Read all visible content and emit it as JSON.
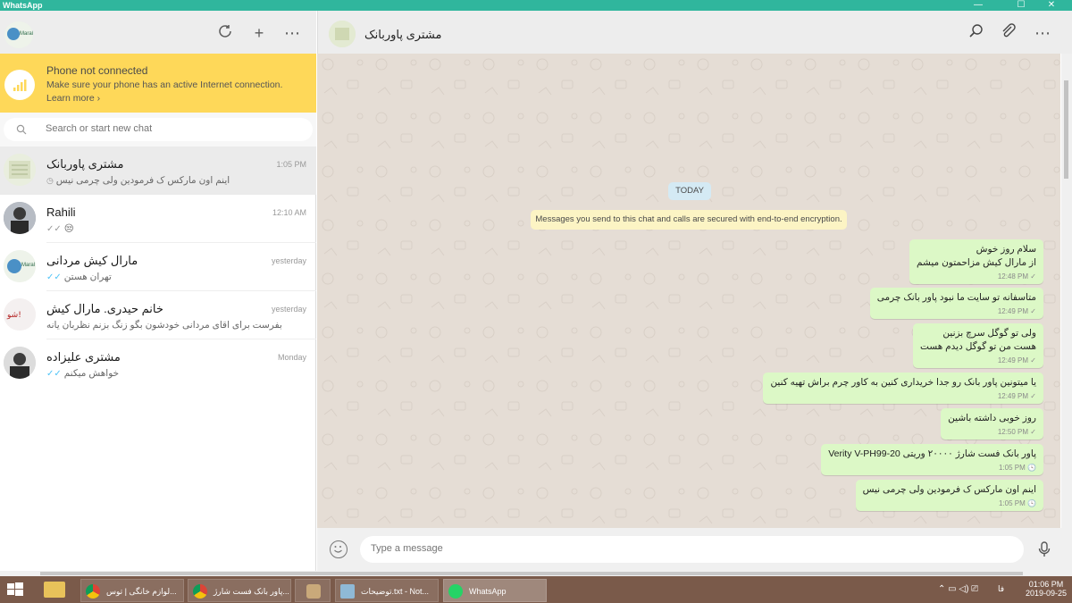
{
  "window": {
    "title": "WhatsApp",
    "minimize": "—",
    "maximize": "☐",
    "close": "✕"
  },
  "left_header": {
    "status_icon": "refresh-icon",
    "new_chat_icon": "+",
    "menu_icon": "⋯"
  },
  "notice": {
    "title": "Phone not connected",
    "line1": "Make sure your phone has an active Internet connection.",
    "link": "Learn more ›"
  },
  "search": {
    "placeholder": "Search or start new chat"
  },
  "chats": [
    {
      "name": "مشتری پاوربانک",
      "time": "1:05 PM",
      "preview": "اینم اون مارکس ک فرمودین ولی چرمی نیس",
      "status": "clock"
    },
    {
      "name": "Rahili",
      "time": "12:10 AM",
      "preview": "😒",
      "status": "✓✓"
    },
    {
      "name": "مارال کیش مردانی",
      "time": "yesterday",
      "preview": "تهران هستن",
      "status": "✓✓"
    },
    {
      "name": "خانم حیدری. مارال کیش",
      "time": "yesterday",
      "preview": "بفرست برای اقای مردانی خودشون بگو زنگ بزنم نظربان یانه",
      "status": ""
    },
    {
      "name": "مشتری علیزاده",
      "time": "Monday",
      "preview": "خواهش میکنم",
      "status": "✓✓"
    }
  ],
  "conversation": {
    "contact_name": "مشتری پاوربانک",
    "today_label": "TODAY",
    "encryption_notice": "Messages you send to this chat and calls are secured with end-to-end encryption.",
    "messages": [
      {
        "lines": [
          "سلام روز خوش",
          "از مارال کیش مزاحمتون میشم"
        ],
        "time": "12:48 PM",
        "status": "✓"
      },
      {
        "lines": [
          "متاسفانه تو سایت ما نبود پاور بانک چرمی"
        ],
        "time": "12:49 PM",
        "status": "✓"
      },
      {
        "lines": [
          "ولی تو گوگل سرچ بزنین",
          "هست من تو گوگل دیدم هست"
        ],
        "time": "12:49 PM",
        "status": "✓"
      },
      {
        "lines": [
          "یا میتونین پاور بانک رو جدا خریداری کنین به کاور چرم براش تهیه کنین"
        ],
        "time": "12:49 PM",
        "status": "✓"
      },
      {
        "lines": [
          "روز خوبی داشته باشین"
        ],
        "time": "12:50 PM",
        "status": "✓"
      },
      {
        "lines": [
          "پاور بانک فست شارژ ۲۰۰۰۰ وریتی Verity V-PH99-20"
        ],
        "time": "1:05 PM",
        "status": "🕓"
      },
      {
        "lines": [
          "اینم اون مارکس ک فرمودین ولی چرمی نیس"
        ],
        "time": "1:05 PM",
        "status": "🕓"
      }
    ]
  },
  "composer": {
    "placeholder": "Type a message"
  },
  "taskbar": {
    "items": [
      {
        "label": "لوازم خانگی | توس..."
      },
      {
        "label": "پاور بانک فست شارژ..."
      },
      {
        "label": ""
      },
      {
        "label": "توضیحات.txt - Not..."
      },
      {
        "label": "WhatsApp"
      }
    ],
    "lang": "فا",
    "time": "01:06 PM",
    "date": "2019-09-25"
  }
}
